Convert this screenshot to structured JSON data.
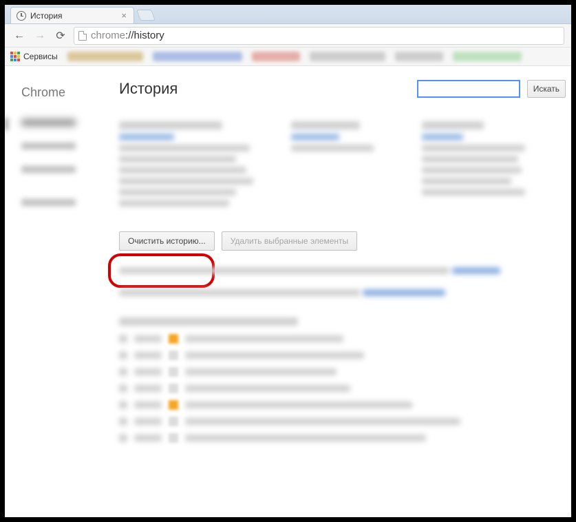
{
  "tab": {
    "title": "История"
  },
  "omnibox": {
    "url_prefix": "chrome",
    "url_rest": "://history"
  },
  "bookmarks_bar": {
    "apps_label": "Сервисы"
  },
  "sidebar": {
    "brand": "Chrome"
  },
  "page": {
    "title": "История"
  },
  "search": {
    "button_label": "Искать"
  },
  "actions": {
    "clear_history": "Очистить историю...",
    "delete_selected": "Удалить выбранные элементы"
  }
}
